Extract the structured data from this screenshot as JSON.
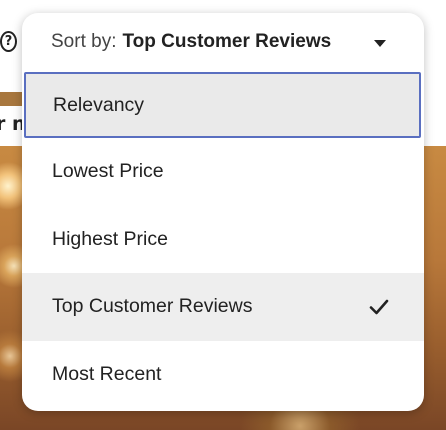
{
  "background": {
    "help_symbol": "?",
    "partial_text": "r n"
  },
  "sort": {
    "prefix": "Sort by:",
    "current": "Top Customer Reviews",
    "caret_icon": "caret-down-icon"
  },
  "options": [
    {
      "label": "Relevancy",
      "focused": true,
      "selected": false
    },
    {
      "label": "Lowest Price",
      "focused": false,
      "selected": false
    },
    {
      "label": "Highest Price",
      "focused": false,
      "selected": false
    },
    {
      "label": "Top Customer Reviews",
      "focused": false,
      "selected": true
    },
    {
      "label": "Most Recent",
      "focused": false,
      "selected": false
    }
  ],
  "colors": {
    "focus_border": "#5a6fc0",
    "highlight_bg": "#eaeaea",
    "text": "#222222"
  }
}
